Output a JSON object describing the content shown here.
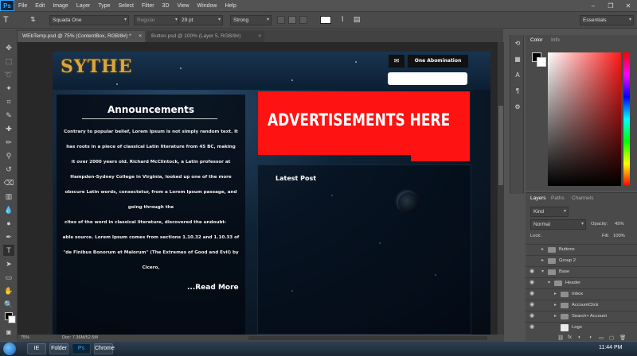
{
  "menubar": {
    "logo": "Ps",
    "items": [
      "File",
      "Edit",
      "Image",
      "Layer",
      "Type",
      "Select",
      "Filter",
      "3D",
      "View",
      "Window",
      "Help"
    ]
  },
  "options": {
    "font_family": "Squada One",
    "font_style": "Regular",
    "font_size": "29 pt",
    "aa_prefix": "aa",
    "antialias": "Strong",
    "workspace": "Essentials"
  },
  "tabs": [
    {
      "label": "WEbTemp.psd @ 75% (ContentBox, RGB/8#) *",
      "close": "×",
      "active": true
    },
    {
      "label": "Button.psd @ 100% (Layer 5, RGB/8#)",
      "close": "×",
      "active": false
    }
  ],
  "document": {
    "logo": "SYTHE",
    "mail_icon": "✉",
    "account_button": "One Abomination",
    "ad_text": "ADVERTISEMENTS HERE",
    "announcements": {
      "title": "Announcements",
      "lines": [
        "Contrary to popular belief, Lorem Ipsum is not simply random text. It",
        "has roots in a piece of classical Latin literature from 45 BC, making",
        "it over 2000 years old. Richard McClintock, a Latin professor at",
        "Hampden-Sydney College in Virginia, looked up one of the more",
        "obscure Latin words, consectetur, from a Lorem Ipsum passage, and",
        "going through the",
        "cites of the word in classical literature, discovered the undoubt-",
        "able source. Lorem Ipsum comes from sections 1.10.32 and 1.10.33 of",
        "\"de Finibus Bonorum et Malorum\" (The Extremes of Good and Evil) by",
        "Cicero,"
      ],
      "read_more": "...Read More"
    },
    "latest_post": "Latest Post"
  },
  "status": {
    "zoom": "75%",
    "doc": "Doc: 7.36M/52.5M"
  },
  "color_panel": {
    "tabs": [
      "Color",
      "Info"
    ]
  },
  "layers_panel": {
    "tabs": [
      "Layers",
      "Paths",
      "Channels"
    ],
    "kind": "Kind",
    "blend": "Normal",
    "opacity_label": "Opacity:",
    "opacity": "45%",
    "lock_label": "Lock:",
    "fill_label": "Fill:",
    "fill": "100%",
    "rows": [
      {
        "name": "Buttons",
        "indent": 0,
        "eye": false,
        "expanded": false,
        "type": "folder"
      },
      {
        "name": "Group 2",
        "indent": 0,
        "eye": false,
        "expanded": false,
        "type": "folder"
      },
      {
        "name": "Base",
        "indent": 0,
        "eye": true,
        "expanded": true,
        "type": "folder"
      },
      {
        "name": "Header",
        "indent": 1,
        "eye": true,
        "expanded": true,
        "type": "folder"
      },
      {
        "name": "Inbox",
        "indent": 2,
        "eye": true,
        "expanded": false,
        "type": "folder"
      },
      {
        "name": "AccountClick",
        "indent": 2,
        "eye": true,
        "expanded": false,
        "type": "folder"
      },
      {
        "name": "Search+ Account",
        "indent": 2,
        "eye": true,
        "expanded": false,
        "type": "folder"
      },
      {
        "name": "Logo",
        "indent": 2,
        "eye": true,
        "expanded": false,
        "type": "layer"
      }
    ],
    "footer_icons": [
      "link-icon",
      "fx-icon",
      "mask-icon",
      "adjustment-icon",
      "group-icon",
      "new-layer-icon",
      "trash-icon"
    ]
  },
  "taskbar": {
    "clock": "11:44 PM",
    "apps": [
      "IE",
      "Folder",
      "Ps",
      "Chrome"
    ]
  },
  "colors": {
    "ad_red": "#ff1212",
    "ps_blue": "#31a8ff",
    "logo_gold": "#d9a83a"
  }
}
